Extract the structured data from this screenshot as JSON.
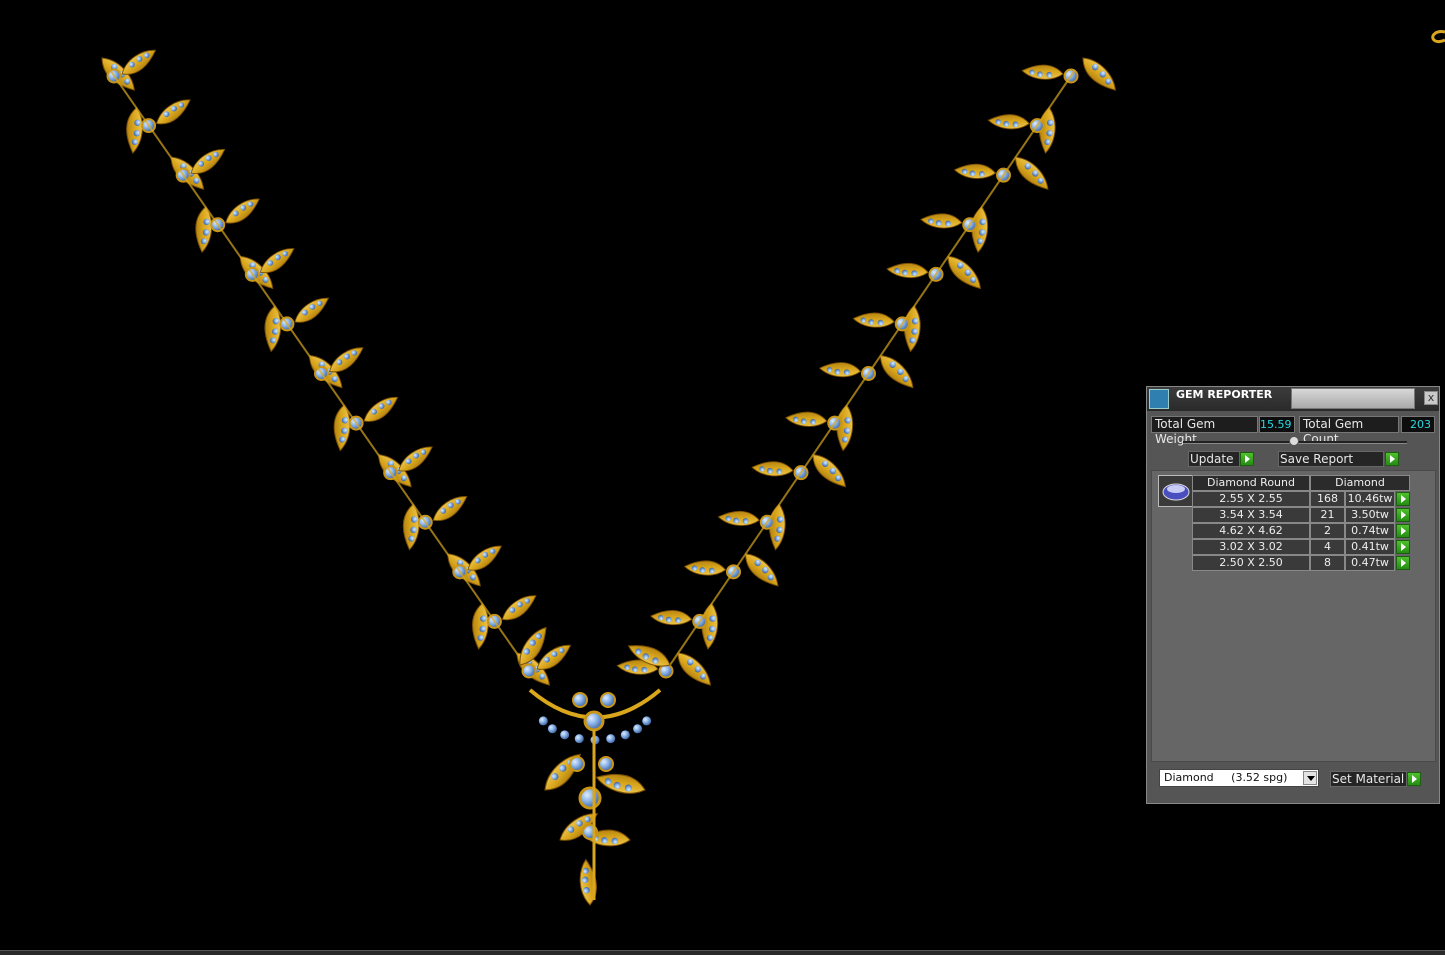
{
  "panel": {
    "title": "GEM REPORTER",
    "close_glyph": "x",
    "total_weight_label": "Total Gem Weight",
    "total_weight_value": "15.59",
    "total_count_label": "Total Gem Count",
    "total_count_value": "203",
    "update_label": "Update",
    "save_report_label": "Save Report",
    "table": {
      "headers": [
        "Diamond Round",
        "Diamond"
      ],
      "rows": [
        {
          "size": "2.55 X 2.55",
          "count": "168",
          "weight": "10.46tw"
        },
        {
          "size": "3.54 X 3.54",
          "count": "21",
          "weight": "3.50tw"
        },
        {
          "size": "4.62 X 4.62",
          "count": "2",
          "weight": "0.74tw"
        },
        {
          "size": "3.02 X 3.02",
          "count": "4",
          "weight": "0.41tw"
        },
        {
          "size": "2.50 X 2.50",
          "count": "8",
          "weight": "0.47tw"
        }
      ]
    },
    "material_value": "Diamond     (3.52 spg)",
    "set_material_label": "Set Material"
  },
  "icons": {
    "title_icon": "gem-reporter-app-icon",
    "close": "close-icon",
    "go": "green-arrow-icon",
    "gem_shape": "round-gem-icon",
    "dropdown": "chevron-down-icon"
  },
  "colors": {
    "gold": "#d9a61c",
    "gem_blue": "#8ab4e8",
    "value_cyan": "#27d8e0",
    "go_green": "#3aa820"
  }
}
